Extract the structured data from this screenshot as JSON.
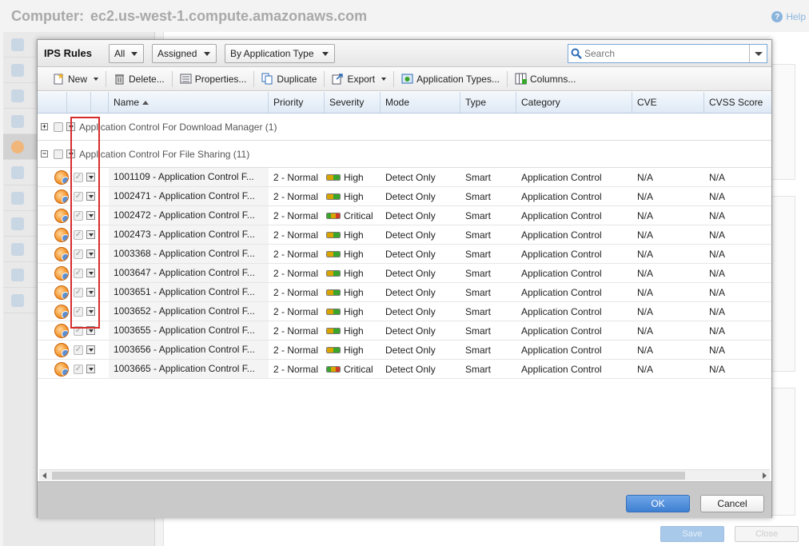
{
  "background": {
    "title_label": "Computer:",
    "title_host": "ec2.us-west-1.compute.amazonaws.com",
    "help_label": "Help",
    "save_label": "Save",
    "close_label": "Close"
  },
  "dialog": {
    "title": "IPS Rules",
    "filter_all": "All",
    "filter_assigned": "Assigned",
    "filter_grouping": "By Application Type",
    "search_placeholder": "Search",
    "toolbar": {
      "new": "New",
      "delete": "Delete...",
      "properties": "Properties...",
      "duplicate": "Duplicate",
      "export": "Export",
      "application_types": "Application Types...",
      "columns": "Columns..."
    },
    "columns": {
      "name": "Name",
      "priority": "Priority",
      "severity": "Severity",
      "mode": "Mode",
      "type": "Type",
      "category": "Category",
      "cve": "CVE",
      "cvss": "CVSS Score"
    },
    "groups": [
      {
        "label": "Application Control For Download Manager (1)",
        "expanded": false
      },
      {
        "label": "Application Control For File Sharing (11)",
        "expanded": true
      }
    ],
    "rows": [
      {
        "name": "1001109 - Application Control F...",
        "priority": "2 - Normal",
        "severity": "High",
        "mode": "Detect Only",
        "type": "Smart",
        "category": "Application Control",
        "cve": "N/A",
        "cvss": "N/A"
      },
      {
        "name": "1002471 - Application Control F...",
        "priority": "2 - Normal",
        "severity": "High",
        "mode": "Detect Only",
        "type": "Smart",
        "category": "Application Control",
        "cve": "N/A",
        "cvss": "N/A"
      },
      {
        "name": "1002472 - Application Control F...",
        "priority": "2 - Normal",
        "severity": "Critical",
        "mode": "Detect Only",
        "type": "Smart",
        "category": "Application Control",
        "cve": "N/A",
        "cvss": "N/A"
      },
      {
        "name": "1002473 - Application Control F...",
        "priority": "2 - Normal",
        "severity": "High",
        "mode": "Detect Only",
        "type": "Smart",
        "category": "Application Control",
        "cve": "N/A",
        "cvss": "N/A"
      },
      {
        "name": "1003368 - Application Control F...",
        "priority": "2 - Normal",
        "severity": "High",
        "mode": "Detect Only",
        "type": "Smart",
        "category": "Application Control",
        "cve": "N/A",
        "cvss": "N/A"
      },
      {
        "name": "1003647 - Application Control F...",
        "priority": "2 - Normal",
        "severity": "High",
        "mode": "Detect Only",
        "type": "Smart",
        "category": "Application Control",
        "cve": "N/A",
        "cvss": "N/A"
      },
      {
        "name": "1003651 - Application Control F...",
        "priority": "2 - Normal",
        "severity": "High",
        "mode": "Detect Only",
        "type": "Smart",
        "category": "Application Control",
        "cve": "N/A",
        "cvss": "N/A"
      },
      {
        "name": "1003652 - Application Control F...",
        "priority": "2 - Normal",
        "severity": "High",
        "mode": "Detect Only",
        "type": "Smart",
        "category": "Application Control",
        "cve": "N/A",
        "cvss": "N/A"
      },
      {
        "name": "1003655 - Application Control F...",
        "priority": "2 - Normal",
        "severity": "High",
        "mode": "Detect Only",
        "type": "Smart",
        "category": "Application Control",
        "cve": "N/A",
        "cvss": "N/A"
      },
      {
        "name": "1003656 - Application Control F...",
        "priority": "2 - Normal",
        "severity": "High",
        "mode": "Detect Only",
        "type": "Smart",
        "category": "Application Control",
        "cve": "N/A",
        "cvss": "N/A"
      },
      {
        "name": "1003665 - Application Control F...",
        "priority": "2 - Normal",
        "severity": "Critical",
        "mode": "Detect Only",
        "type": "Smart",
        "category": "Application Control",
        "cve": "N/A",
        "cvss": "N/A"
      }
    ],
    "ok_label": "OK",
    "cancel_label": "Cancel"
  },
  "colors": {
    "accent": "#3d7fd2",
    "highlight_box": "#d62c2c",
    "severity_high": [
      "#d9a400",
      "#3aa52b"
    ],
    "severity_critical": [
      "#3aa52b",
      "#d9a400",
      "#d13a23"
    ]
  }
}
